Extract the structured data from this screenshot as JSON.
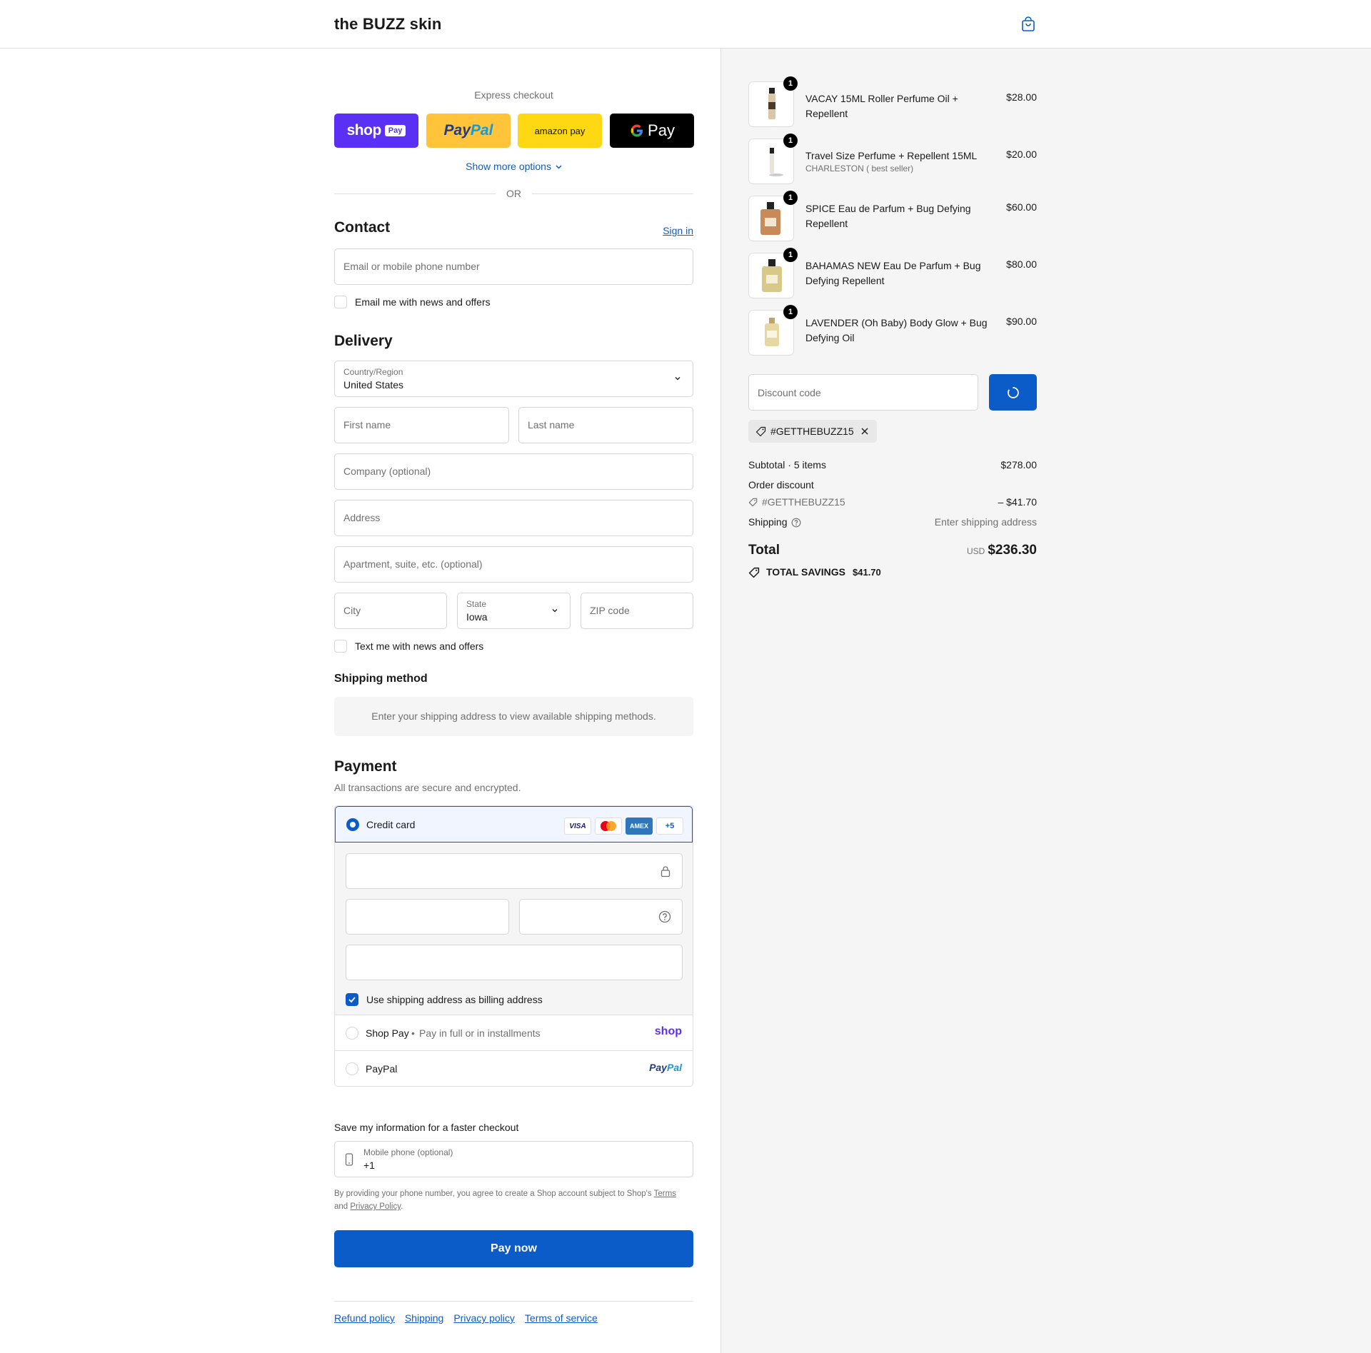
{
  "header": {
    "brand": "the BUZZ skin"
  },
  "express": {
    "label": "Express checkout",
    "shop_pay_text": "shop",
    "shop_pay_badge": "Pay",
    "paypal_text_1": "Pay",
    "paypal_text_2": "Pal",
    "amazon_text": "amazon pay",
    "gpay_text": "Pay",
    "show_more": "Show more options",
    "or": "OR"
  },
  "contact": {
    "title": "Contact",
    "sign_in": "Sign in",
    "email_placeholder": "Email or mobile phone number",
    "email_news": "Email me with news and offers"
  },
  "delivery": {
    "title": "Delivery",
    "country_label": "Country/Region",
    "country_value": "United States",
    "first_name": "First name",
    "last_name": "Last name",
    "company": "Company (optional)",
    "address": "Address",
    "apartment": "Apartment, suite, etc. (optional)",
    "city": "City",
    "state_label": "State",
    "state_value": "Iowa",
    "zip": "ZIP code",
    "text_news": "Text me with news and offers"
  },
  "shipping_method": {
    "title": "Shipping method",
    "info": "Enter your shipping address to view available shipping methods."
  },
  "payment": {
    "title": "Payment",
    "subtitle": "All transactions are secure and encrypted.",
    "credit_card": "Credit card",
    "card_visa": "VISA",
    "card_amex": "AMEX",
    "card_more": "+5",
    "billing_same": "Use shipping address as billing address",
    "shop_pay": "Shop Pay",
    "shop_pay_desc": "Pay in full or in installments",
    "shop_logo": "shop",
    "paypal": "PayPal",
    "paypal_logo_1": "Pay",
    "paypal_logo_2": "Pal"
  },
  "save_info": {
    "title": "Save my information for a faster checkout",
    "phone_label": "Mobile phone (optional)",
    "phone_value": "+1",
    "legal_1": "By providing your phone number, you agree to create a Shop account subject to Shop's ",
    "legal_terms": "Terms",
    "legal_2": "and ",
    "legal_privacy": "Privacy Policy",
    "legal_3": "."
  },
  "pay_now": "Pay now",
  "footer": [
    "Refund policy",
    "Shipping",
    "Privacy policy",
    "Terms of service"
  ],
  "order": {
    "items": [
      {
        "name": "VACAY 15ML Roller Perfume Oil + Repellent",
        "variant": "",
        "price": "$28.00",
        "qty": "1"
      },
      {
        "name": "Travel Size Perfume + Repellent 15ML",
        "variant": "CHARLESTON ( best seller)",
        "price": "$20.00",
        "qty": "1"
      },
      {
        "name": "SPICE Eau de Parfum + Bug Defying Repellent",
        "variant": "",
        "price": "$60.00",
        "qty": "1"
      },
      {
        "name": "BAHAMAS NEW Eau De Parfum + Bug Defying Repellent",
        "variant": "",
        "price": "$80.00",
        "qty": "1"
      },
      {
        "name": "LAVENDER (Oh Baby) Body Glow + Bug Defying Oil",
        "variant": "",
        "price": "$90.00",
        "qty": "1"
      }
    ],
    "discount_placeholder": "Discount code",
    "applied_code": "#GETTHEBUZZ15",
    "subtotal_label": "Subtotal · 5 items",
    "subtotal_value": "$278.00",
    "order_discount_label": "Order discount",
    "discount_code": "#GETTHEBUZZ15",
    "discount_value": "– $41.70",
    "shipping_label": "Shipping",
    "shipping_value": "Enter shipping address",
    "total_label": "Total",
    "currency": "USD",
    "total_value": "$236.30",
    "savings_label": "TOTAL SAVINGS",
    "savings_value": "$41.70"
  },
  "colors": {
    "accent": "#0b5cc9",
    "shop_purple": "#5a31f4",
    "paypal_yellow": "#ffc439",
    "amazon_yellow": "#ffd814"
  }
}
